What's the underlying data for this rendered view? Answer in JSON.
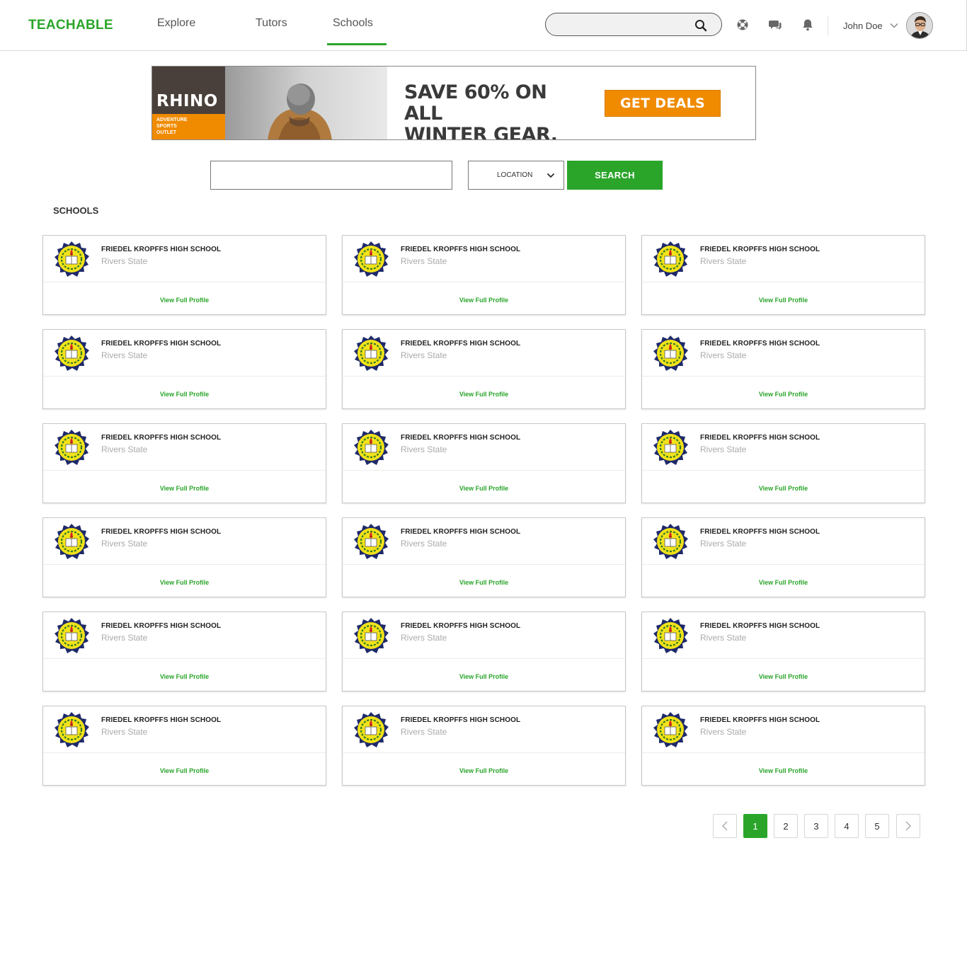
{
  "header": {
    "logo": "TEACHABLE",
    "nav": [
      "Explore",
      "Tutors",
      "Schools"
    ],
    "active_nav": "Schools",
    "search_placeholder": "",
    "user_name": "John Doe"
  },
  "banner": {
    "brand": "RHINO",
    "tagline_lines": [
      "ADVENTURE",
      "SPORTS",
      "OUTLET"
    ],
    "headline_lines": [
      "SAVE 60% ON ALL",
      "WINTER GEAR."
    ],
    "cta": "GET DEALS"
  },
  "filters": {
    "query_value": "",
    "location_label": "LOCATION",
    "search_label": "SEARCH"
  },
  "section_title": "SCHOOLS",
  "schools": [
    {
      "name": "FRIEDEL KROPFFS HIGH SCHOOL",
      "location": "Rivers State",
      "link": "View Full Profile"
    },
    {
      "name": "FRIEDEL KROPFFS HIGH SCHOOL",
      "location": "Rivers State",
      "link": "View Full Profile"
    },
    {
      "name": "FRIEDEL KROPFFS HIGH SCHOOL",
      "location": "Rivers State",
      "link": "View Full Profile"
    },
    {
      "name": "FRIEDEL KROPFFS HIGH SCHOOL",
      "location": "Rivers State",
      "link": "View Full Profile"
    },
    {
      "name": "FRIEDEL KROPFFS HIGH SCHOOL",
      "location": "Rivers State",
      "link": "View Full Profile"
    },
    {
      "name": "FRIEDEL KROPFFS HIGH SCHOOL",
      "location": "Rivers State",
      "link": "View Full Profile"
    },
    {
      "name": "FRIEDEL KROPFFS HIGH SCHOOL",
      "location": "Rivers State",
      "link": "View Full Profile"
    },
    {
      "name": "FRIEDEL KROPFFS HIGH SCHOOL",
      "location": "Rivers State",
      "link": "View Full Profile"
    },
    {
      "name": "FRIEDEL KROPFFS HIGH SCHOOL",
      "location": "Rivers State",
      "link": "View Full Profile"
    },
    {
      "name": "FRIEDEL KROPFFS HIGH SCHOOL",
      "location": "Rivers State",
      "link": "View Full Profile"
    },
    {
      "name": "FRIEDEL KROPFFS HIGH SCHOOL",
      "location": "Rivers State",
      "link": "View Full Profile"
    },
    {
      "name": "FRIEDEL KROPFFS HIGH SCHOOL",
      "location": "Rivers State",
      "link": "View Full Profile"
    },
    {
      "name": "FRIEDEL KROPFFS HIGH SCHOOL",
      "location": "Rivers State",
      "link": "View Full Profile"
    },
    {
      "name": "FRIEDEL KROPFFS HIGH SCHOOL",
      "location": "Rivers State",
      "link": "View Full Profile"
    },
    {
      "name": "FRIEDEL KROPFFS HIGH SCHOOL",
      "location": "Rivers State",
      "link": "View Full Profile"
    },
    {
      "name": "FRIEDEL KROPFFS HIGH SCHOOL",
      "location": "Rivers State",
      "link": "View Full Profile"
    },
    {
      "name": "FRIEDEL KROPFFS HIGH SCHOOL",
      "location": "Rivers State",
      "link": "View Full Profile"
    },
    {
      "name": "FRIEDEL KROPFFS HIGH SCHOOL",
      "location": "Rivers State",
      "link": "View Full Profile"
    }
  ],
  "pagination": {
    "pages": [
      "1",
      "2",
      "3",
      "4",
      "5"
    ],
    "current": "1"
  },
  "colors": {
    "brand_green": "#2aa52a",
    "ad_orange": "#f08b00",
    "ad_dark": "#4a403b"
  },
  "icons": [
    "search-icon",
    "support-icon",
    "chat-icon",
    "bell-icon",
    "chevron-down-icon",
    "school-crest-icon",
    "chevron-left-icon",
    "chevron-right-icon"
  ]
}
